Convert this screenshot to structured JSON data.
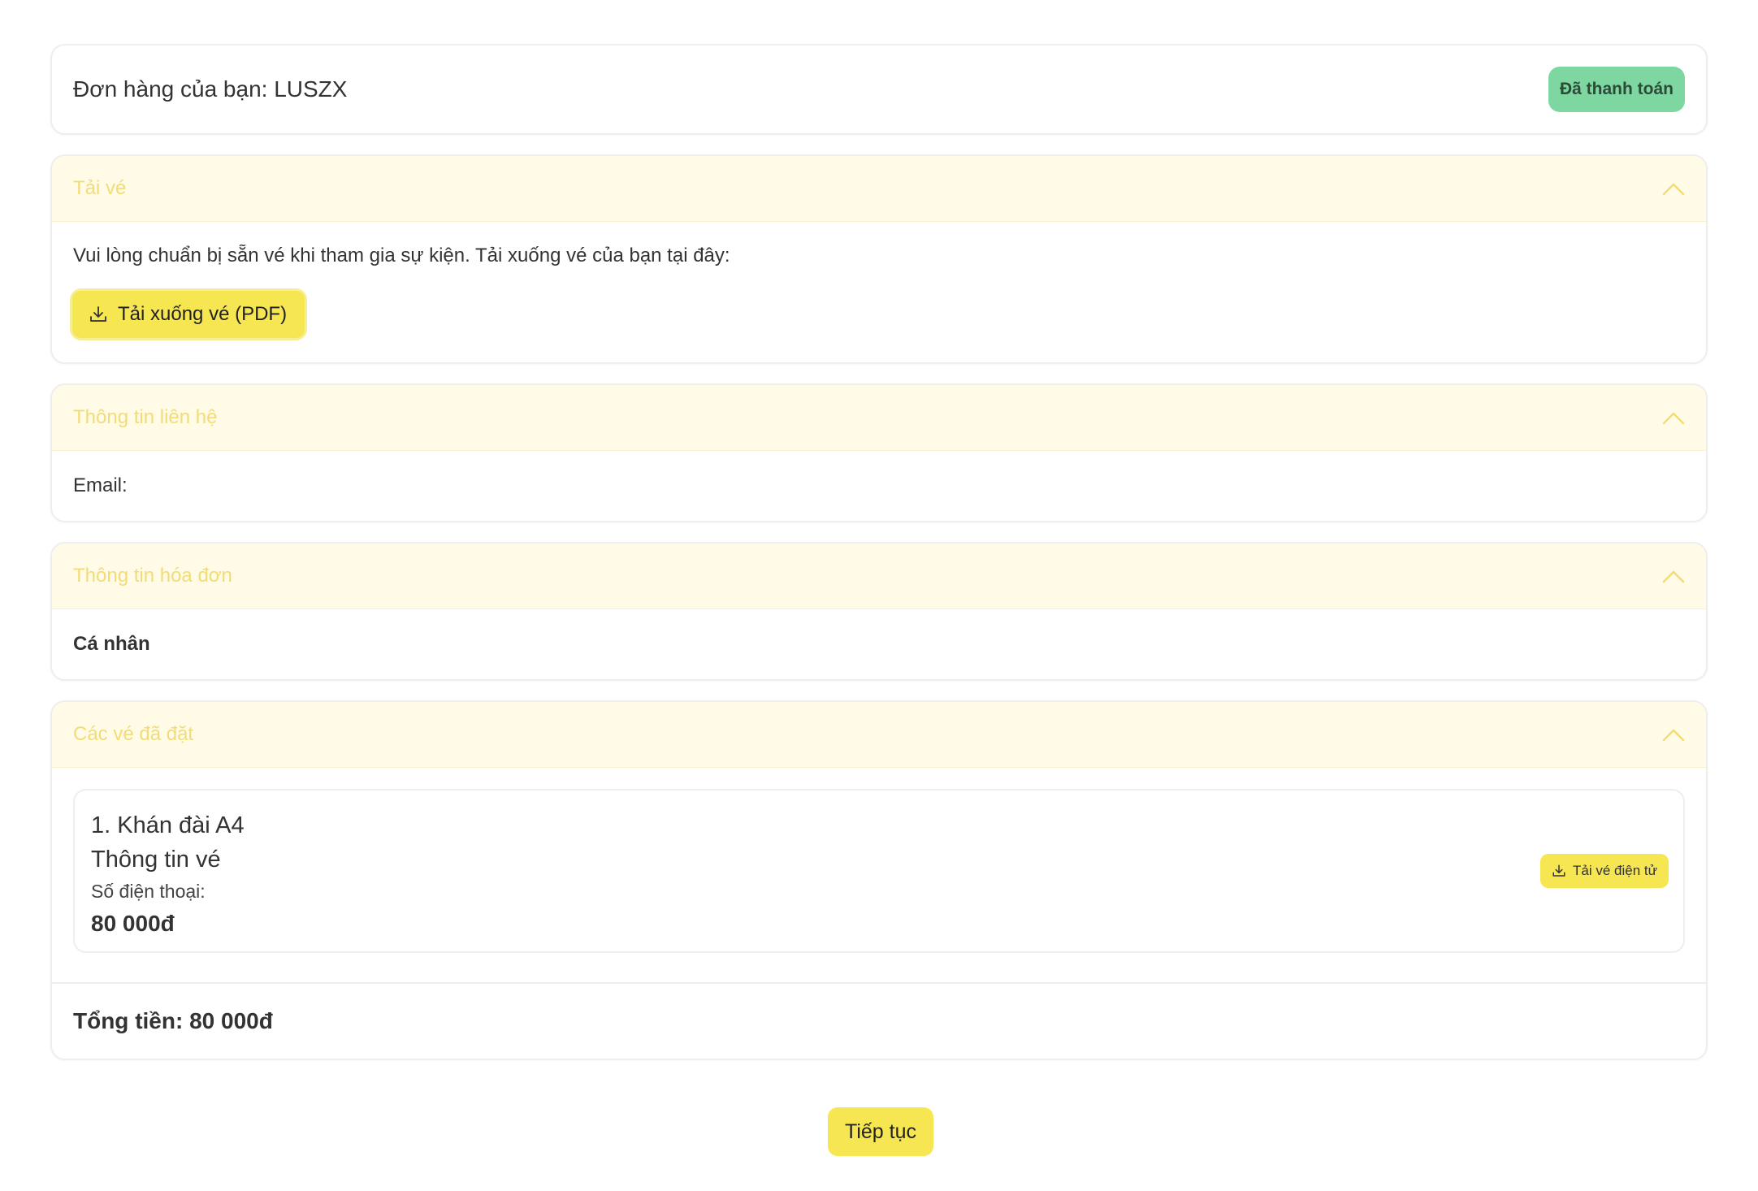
{
  "order": {
    "title": "Đơn hàng của bạn: LUSZX",
    "status_badge": "Đã thanh toán",
    "status_color": "#7ed6a0"
  },
  "download_section": {
    "title": "Tải vé",
    "description": "Vui lòng chuẩn bị sẵn vé khi tham gia sự kiện. Tải xuống vé của bạn tại đây:",
    "button_label": "Tải xuống vé (PDF)"
  },
  "contact_section": {
    "title": "Thông tin liên hệ",
    "email_label": "Email:",
    "email_value": ""
  },
  "billing_section": {
    "title": "Thông tin hóa đơn",
    "type": "Cá nhân"
  },
  "booked_section": {
    "title": "Các vé đã đặt",
    "tickets": [
      {
        "name": "1. Khán đài A4",
        "info_label": "Thông tin vé",
        "phone_label": "Số điện thoại:",
        "price": "80 000đ",
        "eticket_button": "Tải vé điện tử"
      }
    ],
    "total": "Tổng tiền: 80 000đ"
  },
  "footer": {
    "continue_label": "Tiếp tục"
  },
  "colors": {
    "accent_yellow": "#f5e652",
    "header_bg": "#fffbe6",
    "header_text": "#f1dc79"
  },
  "icons": {
    "download": "download-icon",
    "collapse": "chevron-up-icon"
  }
}
